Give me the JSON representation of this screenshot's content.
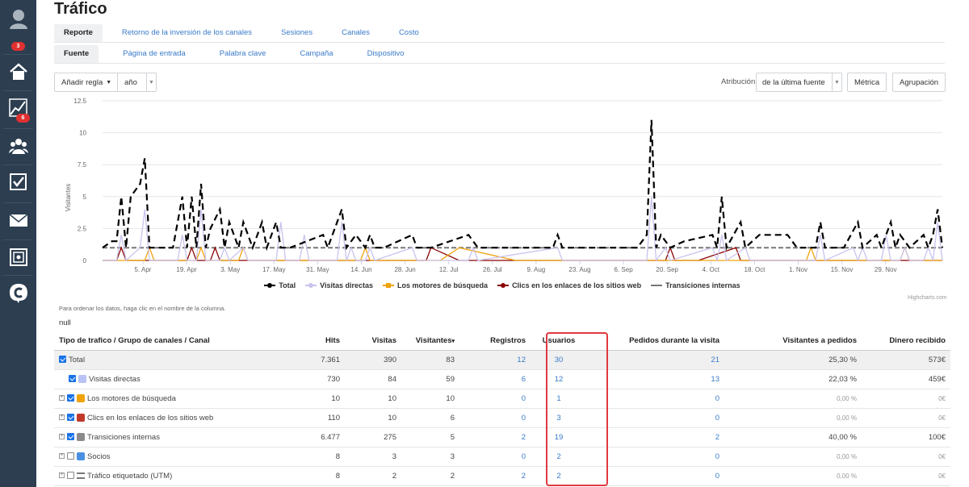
{
  "sidebar": {
    "items": [
      {
        "icon": "user-avatar-icon",
        "badge": "3"
      },
      {
        "icon": "home-icon",
        "badge": ""
      },
      {
        "icon": "chart-trend-icon",
        "badge": "6"
      },
      {
        "icon": "users-icon",
        "badge": ""
      },
      {
        "icon": "tasks-checkbox-icon",
        "badge": ""
      },
      {
        "icon": "mail-icon",
        "badge": ""
      },
      {
        "icon": "safe-icon",
        "badge": ""
      },
      {
        "icon": "brand-c-icon",
        "badge": ""
      }
    ]
  },
  "page": {
    "title": "Tráfico"
  },
  "tabs_primary": [
    "Reporte",
    "Retorno de la inversión de los canales",
    "Sesiones",
    "Canales",
    "Costo"
  ],
  "tabs_secondary": [
    "Fuente",
    "Página de entrada",
    "Palabra clave",
    "Campaña",
    "Dispositivo"
  ],
  "toolbar": {
    "add_rule": "Añadir regla",
    "period": "año",
    "attribution_label": "Atribución",
    "attribution_value": "de la última fuente",
    "metric": "Métrica",
    "grouping": "Agrupación"
  },
  "chart_data": {
    "type": "line",
    "ylabel": "Visitantes",
    "ylim": [
      0,
      12.5
    ],
    "yticks": [
      "0",
      "2.5",
      "5",
      "7.5",
      "10",
      "12.5"
    ],
    "xticks": [
      "5. Apr",
      "19. Apr",
      "3. May",
      "17. May",
      "31. May",
      "14. Jun",
      "28. Jun",
      "12. Jul",
      "26. Jul",
      "9. Aug",
      "23. Aug",
      "6. Sep",
      "20. Sep",
      "4. Oct",
      "18. Oct",
      "1. Nov",
      "15. Nov",
      "29. Nov"
    ],
    "series": [
      {
        "name": "Total",
        "color": "#000000",
        "dashed": true,
        "values": [
          [
            0,
            1
          ],
          [
            2,
            1.5
          ],
          [
            3,
            1.5
          ],
          [
            4,
            5
          ],
          [
            5,
            1
          ],
          [
            6,
            5
          ],
          [
            8,
            6
          ],
          [
            9,
            8
          ],
          [
            10,
            1
          ],
          [
            15,
            1
          ],
          [
            16,
            3
          ],
          [
            17,
            5
          ],
          [
            18,
            1
          ],
          [
            19,
            5
          ],
          [
            20,
            1
          ],
          [
            21,
            6
          ],
          [
            22,
            1
          ],
          [
            23,
            2.5
          ],
          [
            25,
            4
          ],
          [
            26,
            1
          ],
          [
            27,
            3
          ],
          [
            29,
            1
          ],
          [
            30,
            3
          ],
          [
            32,
            1
          ],
          [
            34,
            3
          ],
          [
            35,
            1
          ],
          [
            37,
            3
          ],
          [
            38,
            1
          ],
          [
            40,
            1
          ],
          [
            47,
            2
          ],
          [
            48,
            1
          ],
          [
            51,
            4
          ],
          [
            52,
            1
          ],
          [
            54,
            2
          ],
          [
            56,
            1
          ],
          [
            57,
            2
          ],
          [
            58,
            1
          ],
          [
            60,
            1
          ],
          [
            66,
            2
          ],
          [
            67,
            1
          ],
          [
            70,
            1
          ],
          [
            78,
            2
          ],
          [
            80,
            1
          ],
          [
            96,
            1
          ],
          [
            97,
            2
          ],
          [
            98,
            1
          ],
          [
            114,
            1
          ],
          [
            116,
            2
          ],
          [
            117,
            11
          ],
          [
            118,
            1
          ],
          [
            119,
            2
          ],
          [
            121,
            1
          ],
          [
            124,
            1.5
          ],
          [
            130,
            2
          ],
          [
            131,
            1
          ],
          [
            132,
            5
          ],
          [
            133,
            1
          ],
          [
            136,
            3
          ],
          [
            137,
            1
          ],
          [
            140,
            2
          ],
          [
            146,
            2
          ],
          [
            148,
            1
          ],
          [
            152,
            1
          ],
          [
            153,
            3
          ],
          [
            154,
            1
          ],
          [
            158,
            1
          ],
          [
            161,
            3
          ],
          [
            162,
            1
          ],
          [
            165,
            2
          ],
          [
            166,
            1
          ],
          [
            168,
            3
          ],
          [
            169,
            1
          ],
          [
            170,
            2
          ],
          [
            172,
            1
          ],
          [
            175,
            2
          ],
          [
            176,
            1
          ],
          [
            177,
            2
          ],
          [
            178,
            4
          ],
          [
            179,
            1
          ]
        ]
      },
      {
        "name": "Visitas directas",
        "color": "#c9c3ee",
        "dashed": false,
        "values": [
          [
            0,
            0
          ],
          [
            3,
            0
          ],
          [
            4,
            2
          ],
          [
            5,
            0
          ],
          [
            8,
            1
          ],
          [
            9,
            4
          ],
          [
            10,
            0
          ],
          [
            16,
            0
          ],
          [
            17,
            2
          ],
          [
            18,
            0
          ],
          [
            20,
            0
          ],
          [
            21,
            4
          ],
          [
            22,
            0
          ],
          [
            25,
            0
          ],
          [
            26,
            1
          ],
          [
            27,
            0
          ],
          [
            30,
            1
          ],
          [
            31,
            0
          ],
          [
            37,
            0
          ],
          [
            38,
            3
          ],
          [
            39,
            0
          ],
          [
            42,
            0
          ],
          [
            43,
            2
          ],
          [
            44,
            0
          ],
          [
            50,
            0
          ],
          [
            51,
            3
          ],
          [
            52,
            0
          ],
          [
            53,
            1
          ],
          [
            54,
            0
          ],
          [
            56,
            0
          ],
          [
            57,
            1
          ],
          [
            58,
            0
          ],
          [
            66,
            1
          ],
          [
            67,
            0
          ],
          [
            78,
            0
          ],
          [
            79,
            1
          ],
          [
            80,
            0
          ],
          [
            97,
            1
          ],
          [
            98,
            0
          ],
          [
            116,
            0
          ],
          [
            117,
            5
          ],
          [
            118,
            0
          ],
          [
            120,
            1
          ],
          [
            121,
            0
          ],
          [
            130,
            1
          ],
          [
            131,
            0
          ],
          [
            132,
            2
          ],
          [
            133,
            0
          ],
          [
            137,
            1
          ],
          [
            138,
            0
          ],
          [
            152,
            0
          ],
          [
            153,
            2
          ],
          [
            154,
            0
          ],
          [
            160,
            1
          ],
          [
            161,
            0
          ],
          [
            162,
            1
          ],
          [
            163,
            0
          ],
          [
            166,
            0
          ],
          [
            167,
            2
          ],
          [
            168,
            0
          ],
          [
            170,
            0
          ],
          [
            171,
            1
          ],
          [
            172,
            0
          ],
          [
            175,
            0
          ],
          [
            176,
            1
          ],
          [
            177,
            0
          ],
          [
            178,
            3
          ],
          [
            179,
            0
          ]
        ]
      },
      {
        "name": "Los motores de búsqueda",
        "color": "#f0a30a",
        "dashed": false,
        "values": [
          [
            0,
            0
          ],
          [
            9,
            0
          ],
          [
            10,
            1
          ],
          [
            11,
            0
          ],
          [
            20,
            0
          ],
          [
            21,
            1
          ],
          [
            22,
            0
          ],
          [
            29,
            0
          ],
          [
            30,
            1
          ],
          [
            31,
            0
          ],
          [
            55,
            0
          ],
          [
            56,
            1
          ],
          [
            57,
            0
          ],
          [
            72,
            0
          ],
          [
            76,
            1
          ],
          [
            88,
            0
          ],
          [
            150,
            0
          ],
          [
            151,
            1
          ],
          [
            152,
            0
          ],
          [
            170,
            0
          ],
          [
            171,
            1
          ],
          [
            172,
            0
          ],
          [
            179,
            0
          ]
        ]
      },
      {
        "name": "Clics en los enlaces de los sitios web",
        "color": "#8b0000",
        "dashed": false,
        "values": [
          [
            0,
            0
          ],
          [
            3,
            0
          ],
          [
            4,
            1
          ],
          [
            5,
            0
          ],
          [
            18,
            0
          ],
          [
            19,
            1
          ],
          [
            20,
            0
          ],
          [
            23,
            0
          ],
          [
            24,
            1
          ],
          [
            25,
            0
          ],
          [
            69,
            0
          ],
          [
            70,
            1
          ],
          [
            76,
            0
          ],
          [
            120,
            0
          ],
          [
            121,
            1
          ],
          [
            122,
            0
          ],
          [
            127,
            0
          ],
          [
            135,
            1
          ],
          [
            136,
            0
          ],
          [
            179,
            0
          ]
        ]
      },
      {
        "name": "Transiciones internas",
        "color": "#777777",
        "dashed": false,
        "values": [
          [
            0,
            1
          ],
          [
            179,
            1
          ]
        ]
      }
    ]
  },
  "chart_credit": "Highcharts.com",
  "table_hint": "Para ordenar los datos, haga clic en el nombre de la columna.",
  "null_text": "null",
  "table": {
    "headers": [
      "Tipo de trafico / Grupo de canales / Canal",
      "Hits",
      "Visitas",
      "Visitantes",
      "Registros",
      "Usuarios",
      "Pedidos durante la visita",
      "Visitantes a pedidos",
      "Dinero recibido"
    ],
    "sort_indicator": "▾",
    "rows": [
      {
        "name": "Total",
        "checked": true,
        "expand": false,
        "icon": "",
        "hits": "7.361",
        "visitas": "390",
        "visitantes": "83",
        "registros": "12",
        "usuarios": "30",
        "pedidos": "21",
        "vap": "25,30 %",
        "dinero": "573€",
        "dim": false
      },
      {
        "name": "Visitas directas",
        "checked": true,
        "expand": false,
        "icon": "direct-icon",
        "hits": "730",
        "visitas": "84",
        "visitantes": "59",
        "registros": "6",
        "usuarios": "12",
        "pedidos": "13",
        "vap": "22,03 %",
        "dinero": "459€",
        "dim": false
      },
      {
        "name": "Los motores de búsqueda",
        "checked": true,
        "expand": true,
        "icon": "search-engine-icon",
        "hits": "10",
        "visitas": "10",
        "visitantes": "10",
        "registros": "0",
        "usuarios": "1",
        "pedidos": "0",
        "vap": "0,00 %",
        "dinero": "0€",
        "dim": true
      },
      {
        "name": "Clics en los enlaces de los sitios web",
        "checked": true,
        "expand": true,
        "icon": "link-icon",
        "hits": "110",
        "visitas": "10",
        "visitantes": "6",
        "registros": "0",
        "usuarios": "3",
        "pedidos": "0",
        "vap": "0,00 %",
        "dinero": "0€",
        "dim": true
      },
      {
        "name": "Transiciones internas",
        "checked": true,
        "expand": true,
        "icon": "internal-icon",
        "hits": "6.477",
        "visitas": "275",
        "visitantes": "5",
        "registros": "2",
        "usuarios": "19",
        "pedidos": "2",
        "vap": "40,00 %",
        "dinero": "100€",
        "dim": false
      },
      {
        "name": "Socios",
        "checked": false,
        "expand": true,
        "icon": "partner-icon",
        "hits": "8",
        "visitas": "3",
        "visitantes": "3",
        "registros": "0",
        "usuarios": "2",
        "pedidos": "0",
        "vap": "0,00 %",
        "dinero": "0€",
        "dim": true
      },
      {
        "name": "Tráfico etiquetado (UTM)",
        "checked": false,
        "expand": true,
        "icon": "list-icon",
        "hits": "8",
        "visitas": "2",
        "visitantes": "2",
        "registros": "2",
        "usuarios": "2",
        "pedidos": "0",
        "vap": "0,00 %",
        "dinero": "0€",
        "dim": true
      }
    ]
  },
  "colors": {
    "sidebar": "#2c3e50",
    "link": "#3a7bc8",
    "highlight": "#e0393e",
    "badge": "#e03131"
  }
}
